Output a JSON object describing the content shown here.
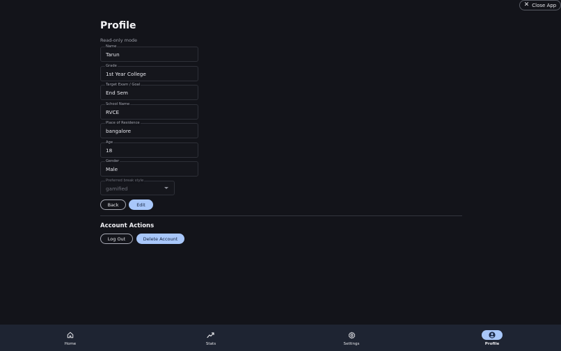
{
  "close_app": {
    "label": "Close App",
    "icon": "close-icon"
  },
  "page": {
    "title": "Profile",
    "mode": "Read-only mode"
  },
  "fields": [
    {
      "label": "Name",
      "value": "Tarun"
    },
    {
      "label": "Grade",
      "value": "1st Year College"
    },
    {
      "label": "Target Exam / Goal",
      "value": "End Sem"
    },
    {
      "label": "School Name",
      "value": "RVCE"
    },
    {
      "label": "Place of Residence",
      "value": "bangalore"
    },
    {
      "label": "Age",
      "value": "18"
    },
    {
      "label": "Gender",
      "value": "Male"
    }
  ],
  "break_style": {
    "label": "Preferred break style",
    "value": "gamified"
  },
  "actions": {
    "back": "Back",
    "edit": "Edit"
  },
  "account": {
    "title": "Account Actions",
    "logout": "Log Out",
    "delete": "Delete Account"
  },
  "nav": {
    "items": [
      {
        "label": "Home",
        "icon": "home-icon"
      },
      {
        "label": "Stats",
        "icon": "stats-icon"
      },
      {
        "label": "Settings",
        "icon": "gear-icon"
      },
      {
        "label": "Profile",
        "icon": "profile-icon",
        "active": true
      }
    ]
  },
  "colors": {
    "accent": "#a8c7fa",
    "background": "#13141a",
    "nav_bg": "#1e2432"
  }
}
